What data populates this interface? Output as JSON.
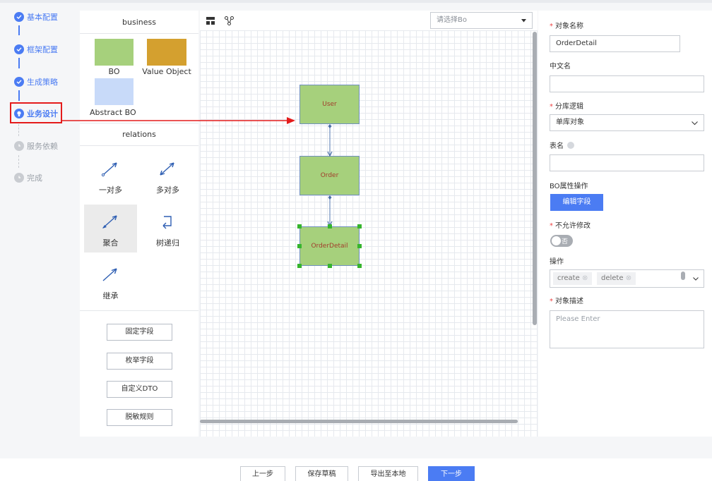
{
  "steps": [
    {
      "label": "基本配置",
      "status": "done"
    },
    {
      "label": "框架配置",
      "status": "done"
    },
    {
      "label": "生成策略",
      "status": "done"
    },
    {
      "label": "业务设计",
      "status": "active"
    },
    {
      "label": "服务依赖",
      "status": "pending"
    },
    {
      "label": "完成",
      "status": "pending"
    }
  ],
  "palette": {
    "business_title": "business",
    "items": [
      {
        "label": "BO",
        "color": "#a6d07c"
      },
      {
        "label": "Value Object",
        "color": "#d4a02f"
      },
      {
        "label": "Abstract BO",
        "color": "#c8daf9"
      }
    ],
    "relations_title": "relations",
    "relations": [
      {
        "label": "一对多",
        "icon": "one-to-many-arrow-icon"
      },
      {
        "label": "多对多",
        "icon": "many-to-many-arrow-icon"
      },
      {
        "label": "聚合",
        "icon": "aggregation-arrow-icon",
        "selected": true
      },
      {
        "label": "树递归",
        "icon": "tree-recursion-icon"
      },
      {
        "label": "继承",
        "icon": "inheritance-arrow-icon"
      }
    ],
    "field_buttons": [
      "固定字段",
      "枚举字段",
      "自定义DTO",
      "脱敏规则"
    ]
  },
  "canvas": {
    "select_placeholder": "请选择Bo",
    "nodes": [
      "User",
      "Order",
      "OrderDetail"
    ],
    "selected_node": "OrderDetail"
  },
  "form": {
    "name_label": "对象名称",
    "name_value": "OrderDetail",
    "cn_name_label": "中文名",
    "cn_name_value": "",
    "shard_label": "分库逻辑",
    "shard_value": "单库对象",
    "table_label": "表名",
    "table_value": "",
    "bo_ops_label": "BO属性操作",
    "edit_fields_button": "编辑字段",
    "no_modify_label": "不允许修改",
    "no_modify_toggle": "否",
    "ops_label": "操作",
    "ops_tags": [
      "create",
      "delete"
    ],
    "desc_label": "对象描述",
    "desc_placeholder": "Please Enter"
  },
  "footer": {
    "prev": "上一步",
    "save_draft": "保存草稿",
    "export": "导出至本地",
    "next": "下一步"
  },
  "colors": {
    "accent": "#4b7cf3",
    "bo_node": "#a6d07c",
    "annotation_red": "#e41b1b"
  }
}
